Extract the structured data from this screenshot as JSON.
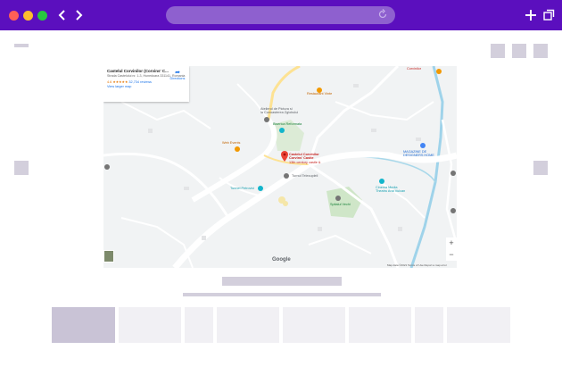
{
  "browser": {
    "back_icon": "chevron-left-icon",
    "forward_icon": "chevron-right-icon",
    "reload_icon": "reload-icon",
    "new_tab_icon": "plus-icon",
    "tabs_icon": "tabs-icon",
    "bar_color": "#5b0fbe",
    "url_color": "#8e60cf"
  },
  "map": {
    "place_title": "Castelul Corvinilor (Corvins' C...",
    "address": "Strada Castelului nr. 1-3, Hunedoara 331141, Romania",
    "rating": "4.6 ★★★★★",
    "reviews": "32,734 reviews",
    "larger_map": "View larger map",
    "directions": "Directions",
    "labels": {
      "restaurant_vinte": "Restaurant Vinte",
      "corvinilor": "Corvinilor",
      "atelierul": "Atelierul de Pictura si\nla Cunoasterea Zglobului",
      "biserica": "Biserica Reformata",
      "lemk_events": "Web Events",
      "castel_name": "Castelul Corvinilor\nCorvins' Castle",
      "castel_sub": "13th century castle &",
      "turnul": "Turnul Telecupleli",
      "tunnel": "Tunnel Petrovici",
      "magazine": "MAGAZINE DE\nDESIGNERS HOME",
      "cinema": "Cinema Media\nTheatru Ana Vulcan",
      "spitalul": "Spitalul Vechi",
      "google": "Google",
      "footer": "Map data ©2021   Terms of Use   Report a map error"
    },
    "zoom_in": "+",
    "zoom_out": "−"
  }
}
